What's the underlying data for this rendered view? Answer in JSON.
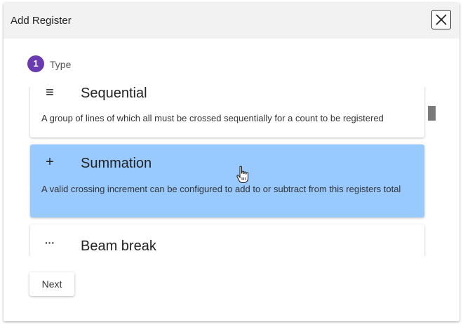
{
  "dialog": {
    "title": "Add Register",
    "close_icon": "close-icon"
  },
  "stepper": {
    "number": "1",
    "label": "Type",
    "color": "#6a3ab0"
  },
  "register_types": [
    {
      "icon": "lines-icon",
      "icon_glyph": "≡",
      "title": "Sequential",
      "description": "A group of lines of which all must be crossed sequentially for a count to be registered",
      "selected": false
    },
    {
      "icon": "plus-icon",
      "icon_glyph": "+",
      "title": "Summation",
      "description": "A valid crossing increment can be configured to add to or subtract from this registers total",
      "selected": true
    },
    {
      "icon": "dots-icon",
      "icon_glyph": "···",
      "title": "Beam break",
      "description": "",
      "selected": false
    }
  ],
  "actions": {
    "next_label": "Next"
  },
  "colors": {
    "selected_card": "#99caff",
    "header_bg": "#f2f2f2"
  }
}
